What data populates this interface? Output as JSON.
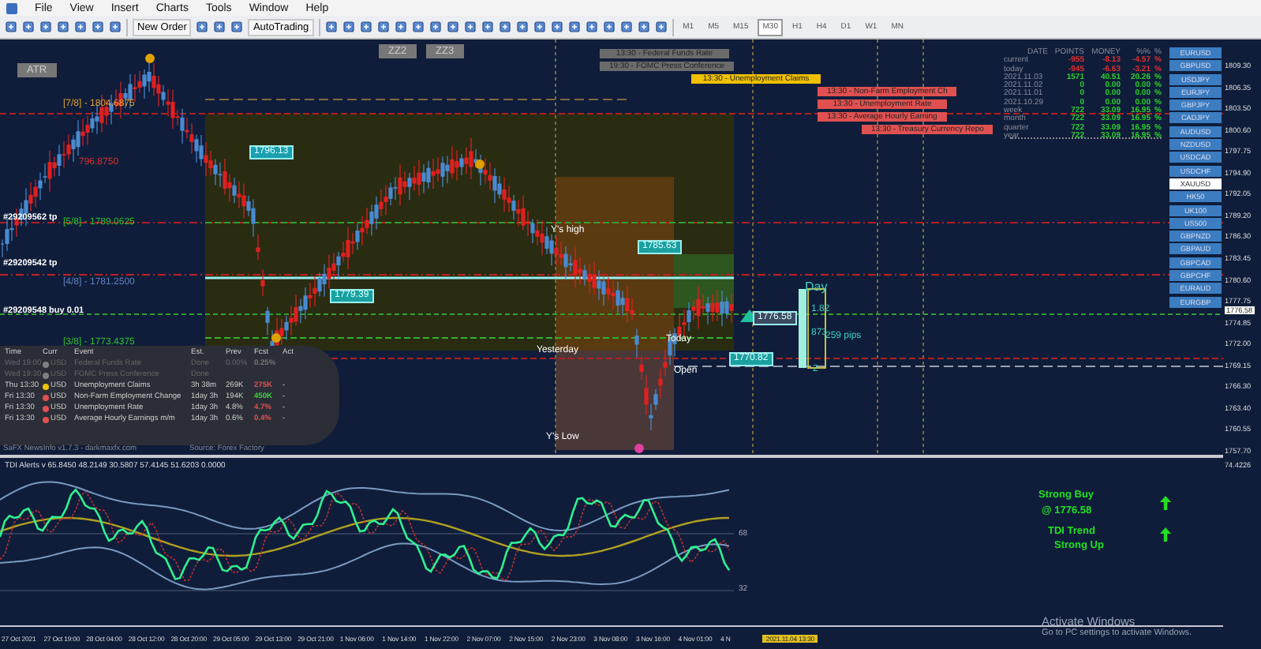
{
  "menu": [
    "File",
    "View",
    "Insert",
    "Charts",
    "Tools",
    "Window",
    "Help"
  ],
  "toolbar": {
    "new_order": "New Order",
    "autotrading": "AutoTrading",
    "timeframes": [
      {
        "label": "M1",
        "selected": false
      },
      {
        "label": "M5",
        "selected": false
      },
      {
        "label": "M15",
        "selected": false
      },
      {
        "label": "M30",
        "selected": true
      },
      {
        "label": "H1",
        "selected": false
      },
      {
        "label": "H4",
        "selected": false
      },
      {
        "label": "D1",
        "selected": false
      },
      {
        "label": "W1",
        "selected": false
      },
      {
        "label": "MN",
        "selected": false
      }
    ]
  },
  "chart_buttons": [
    "ATR",
    "ZZ2",
    "ZZ3"
  ],
  "news_bars": [
    {
      "text": "13:30 - Federal Funds Rate",
      "color": "#6b6b6b"
    },
    {
      "text": "19:30 - FOMC Press Conference",
      "color": "#6b6b6b"
    },
    {
      "text": "13:30 - Unemployment Claims",
      "color": "#f0c000"
    },
    {
      "text": "13:30 - Non-Farm Employment Ch",
      "color": "#e05050"
    },
    {
      "text": "13:30 - Unemployment Rate",
      "color": "#e05050"
    },
    {
      "text": "13:30 - Average Hourly Earning",
      "color": "#e05050"
    },
    {
      "text": "13:30 - Treasury Currency Repo",
      "color": "#e05050"
    }
  ],
  "chart_labels": [
    {
      "text": "[7/8] - 1804.6875",
      "kind": "level",
      "color": "#e0a030"
    },
    {
      "text": "796.8750",
      "kind": "level",
      "color": "#e03030"
    },
    {
      "text": "[5/8] - 1789.0625",
      "kind": "level",
      "color": "#30c030"
    },
    {
      "text": "[4/8] - 1781.2500",
      "kind": "level",
      "color": "#6080c0"
    },
    {
      "text": "[3/8] - 1773.4375",
      "kind": "level",
      "color": "#30c030"
    },
    {
      "text": "#29209562 tp",
      "kind": "order",
      "color": "#ffffff"
    },
    {
      "text": "#29209542 tp",
      "kind": "order",
      "color": "#ffffff"
    },
    {
      "text": "#29209548 buy 0.01",
      "kind": "order",
      "color": "#ffffff"
    },
    {
      "text": "1796.13",
      "kind": "tag",
      "color": "#1aa0b0"
    },
    {
      "text": "1779.39",
      "kind": "tag",
      "color": "#1aa0a0"
    },
    {
      "text": "1785.63",
      "kind": "tag",
      "color": "#1aa0a0"
    },
    {
      "text": "1776.58",
      "kind": "tag",
      "color": "#3a4a60"
    },
    {
      "text": "1770.82",
      "kind": "tag",
      "color": "#1aa0a0"
    },
    {
      "text": "Y's high",
      "kind": "note",
      "color": "#ffffff"
    },
    {
      "text": "Yesterday",
      "kind": "note",
      "color": "#ffffff"
    },
    {
      "text": "Today",
      "kind": "note",
      "color": "#ffffff"
    },
    {
      "text": "Open",
      "kind": "note",
      "color": "#ffffff"
    },
    {
      "text": "Y's Low",
      "kind": "note",
      "color": "#ffffff"
    },
    {
      "text": "Day",
      "kind": "day",
      "color": "#40d0c0"
    },
    {
      "text": "1.82",
      "kind": "note",
      "color": "#40d0c0"
    },
    {
      "text": "873",
      "kind": "note",
      "color": "#40d0c0"
    },
    {
      "text": "259 pips",
      "kind": "note",
      "color": "#40d0c0"
    },
    {
      "text": "2",
      "kind": "note",
      "color": "#40d0c0"
    }
  ],
  "news_table": {
    "columns": [
      "Time",
      "Curr",
      "Event",
      "Est.",
      "Prev",
      "Fcst",
      "Act"
    ],
    "rows": [
      {
        "time": "Wed 19:00",
        "curr": "USD",
        "event": "Federal Funds Rate",
        "est": "Done",
        "prev": "0.00%",
        "fcst": "0.25%",
        "done": true,
        "color": "#808080"
      },
      {
        "time": "Wed 19:30",
        "curr": "USD",
        "event": "FOMC Press Conference",
        "est": "Done",
        "done": true,
        "color": "#808080"
      },
      {
        "time": "Thu 13:30",
        "curr": "USD",
        "event": "Unemployment Claims",
        "est": "3h 38m",
        "prev": "269K",
        "fcst": "275K",
        "act": "-",
        "done": false,
        "color": "#f0c000",
        "fcst_better": false
      },
      {
        "time": "Fri 13:30",
        "curr": "USD",
        "event": "Non-Farm Employment Change",
        "est": "1day 3h",
        "prev": "194K",
        "fcst": "450K",
        "act": "-",
        "done": false,
        "color": "#e05050",
        "fcst_better": true
      },
      {
        "time": "Fri 13:30",
        "curr": "USD",
        "event": "Unemployment Rate",
        "est": "1day 3h",
        "prev": "4.8%",
        "fcst": "4.7%",
        "act": "-",
        "done": false,
        "color": "#e05050",
        "fcst_better": false
      },
      {
        "time": "Fri 13:30",
        "curr": "USD",
        "event": "Average Hourly Earnings m/m",
        "est": "1day 3h",
        "prev": "0.6%",
        "fcst": "0.4%",
        "act": "-",
        "done": false,
        "color": "#e05050",
        "fcst_better": false
      }
    ],
    "footer": "SaFX NewsInfo v1.7.3 - darkmaxfx.com",
    "source": "Source: Forex Factory"
  },
  "stats": {
    "columns": [
      "DATE",
      "POINTS",
      "MONEY",
      "%%",
      "%"
    ],
    "rows": [
      {
        "date": "current",
        "points": "-955",
        "money": "-8.13",
        "pct": "-4.57",
        "unit": "%",
        "color": "#e03030"
      },
      {
        "date": "today",
        "points": "-945",
        "money": "-6.63",
        "pct": "-3.21",
        "unit": "%",
        "color": "#e03030"
      },
      {
        "date": "2021.11.03",
        "points": "1571",
        "money": "40.51",
        "pct": "20.26",
        "unit": "%",
        "color": "#30d030"
      },
      {
        "date": "2021.11.02",
        "points": "0",
        "money": "0.00",
        "pct": "0.00",
        "unit": "%",
        "color": "#30d030"
      },
      {
        "date": "2021.11.01",
        "points": "0",
        "money": "0.00",
        "pct": "0.00",
        "unit": "%",
        "color": "#30d030"
      },
      {
        "date": "2021.10.29",
        "points": "0",
        "money": "0.00",
        "pct": "0.00",
        "unit": "%",
        "color": "#30d030"
      },
      {
        "date": "week",
        "points": "722",
        "money": "33.09",
        "pct": "16.95",
        "unit": "%",
        "color": "#30d030"
      },
      {
        "date": "month",
        "points": "722",
        "money": "33.09",
        "pct": "16.95",
        "unit": "%",
        "color": "#30d030"
      },
      {
        "date": "quarter",
        "points": "722",
        "money": "33.09",
        "pct": "16.95",
        "unit": "%",
        "color": "#30d030"
      },
      {
        "date": "year",
        "points": "722",
        "money": "33.09",
        "pct": "16.95",
        "unit": "%",
        "color": "#30d030"
      }
    ]
  },
  "symbols": [
    {
      "label": "EURUSD",
      "selected": false
    },
    {
      "label": "GBPUSD",
      "selected": false
    },
    {
      "label": "USDJPY",
      "selected": false
    },
    {
      "label": "EURJPY",
      "selected": false
    },
    {
      "label": "GBPJPY",
      "selected": false
    },
    {
      "label": "CADJPY",
      "selected": false
    },
    {
      "label": "AUDUSD",
      "selected": false
    },
    {
      "label": "NZDUSD",
      "selected": false
    },
    {
      "label": "USDCAD",
      "selected": false
    },
    {
      "label": "USDCHF",
      "selected": false
    },
    {
      "label": "XAUUSD",
      "selected": true
    },
    {
      "label": "HK50",
      "selected": false
    },
    {
      "label": "UK100",
      "selected": false
    },
    {
      "label": "US500",
      "selected": false
    },
    {
      "label": "GBPNZD",
      "selected": false
    },
    {
      "label": "GBPAUD",
      "selected": false
    },
    {
      "label": "GBPCAD",
      "selected": false
    },
    {
      "label": "GBPCHF",
      "selected": false
    },
    {
      "label": "EURAUD",
      "selected": false
    },
    {
      "label": "EURGBP",
      "selected": false
    }
  ],
  "price_axis": [
    "1809.30",
    "1806.35",
    "1803.50",
    "1800.60",
    "1797.75",
    "1794.90",
    "1792.05",
    "1789.20",
    "1786.30",
    "1783.45",
    "1780.60",
    "1777.75",
    "1774.85",
    "1772.00",
    "1769.15",
    "1766.30",
    "1763.40",
    "1760.55",
    "1757.70"
  ],
  "current_price": "1776.58",
  "indicator": {
    "title": "TDI Alerts v 65.8450 48.2149 30.5807 57.4145 51.6203 0.0000",
    "levels": [
      "68",
      "32"
    ],
    "axis": [
      "74.4226"
    ]
  },
  "signals": {
    "buy": "Strong Buy",
    "price": "@ 1776.58",
    "trend": "TDI Trend",
    "trend_value": "Strong Up"
  },
  "time_axis": [
    "27 Oct 2021",
    "27 Oct 19:00",
    "28 Oct 04:00",
    "28 Oct 12:00",
    "28 Oct 20:00",
    "29 Oct 05:00",
    "29 Oct 13:00",
    "29 Oct 21:00",
    "1 Nov 06:00",
    "1 Nov 14:00",
    "1 Nov 22:00",
    "2 Nov 07:00",
    "2 Nov 15:00",
    "2 Nov 23:00",
    "3 Nov 08:00",
    "3 Nov 16:00",
    "4 Nov 01:00",
    "4 N"
  ],
  "time_tag": "2021.11.04 13:30",
  "os_notice": {
    "title": "Activate Windows",
    "text": "Go to PC settings to activate Windows."
  }
}
